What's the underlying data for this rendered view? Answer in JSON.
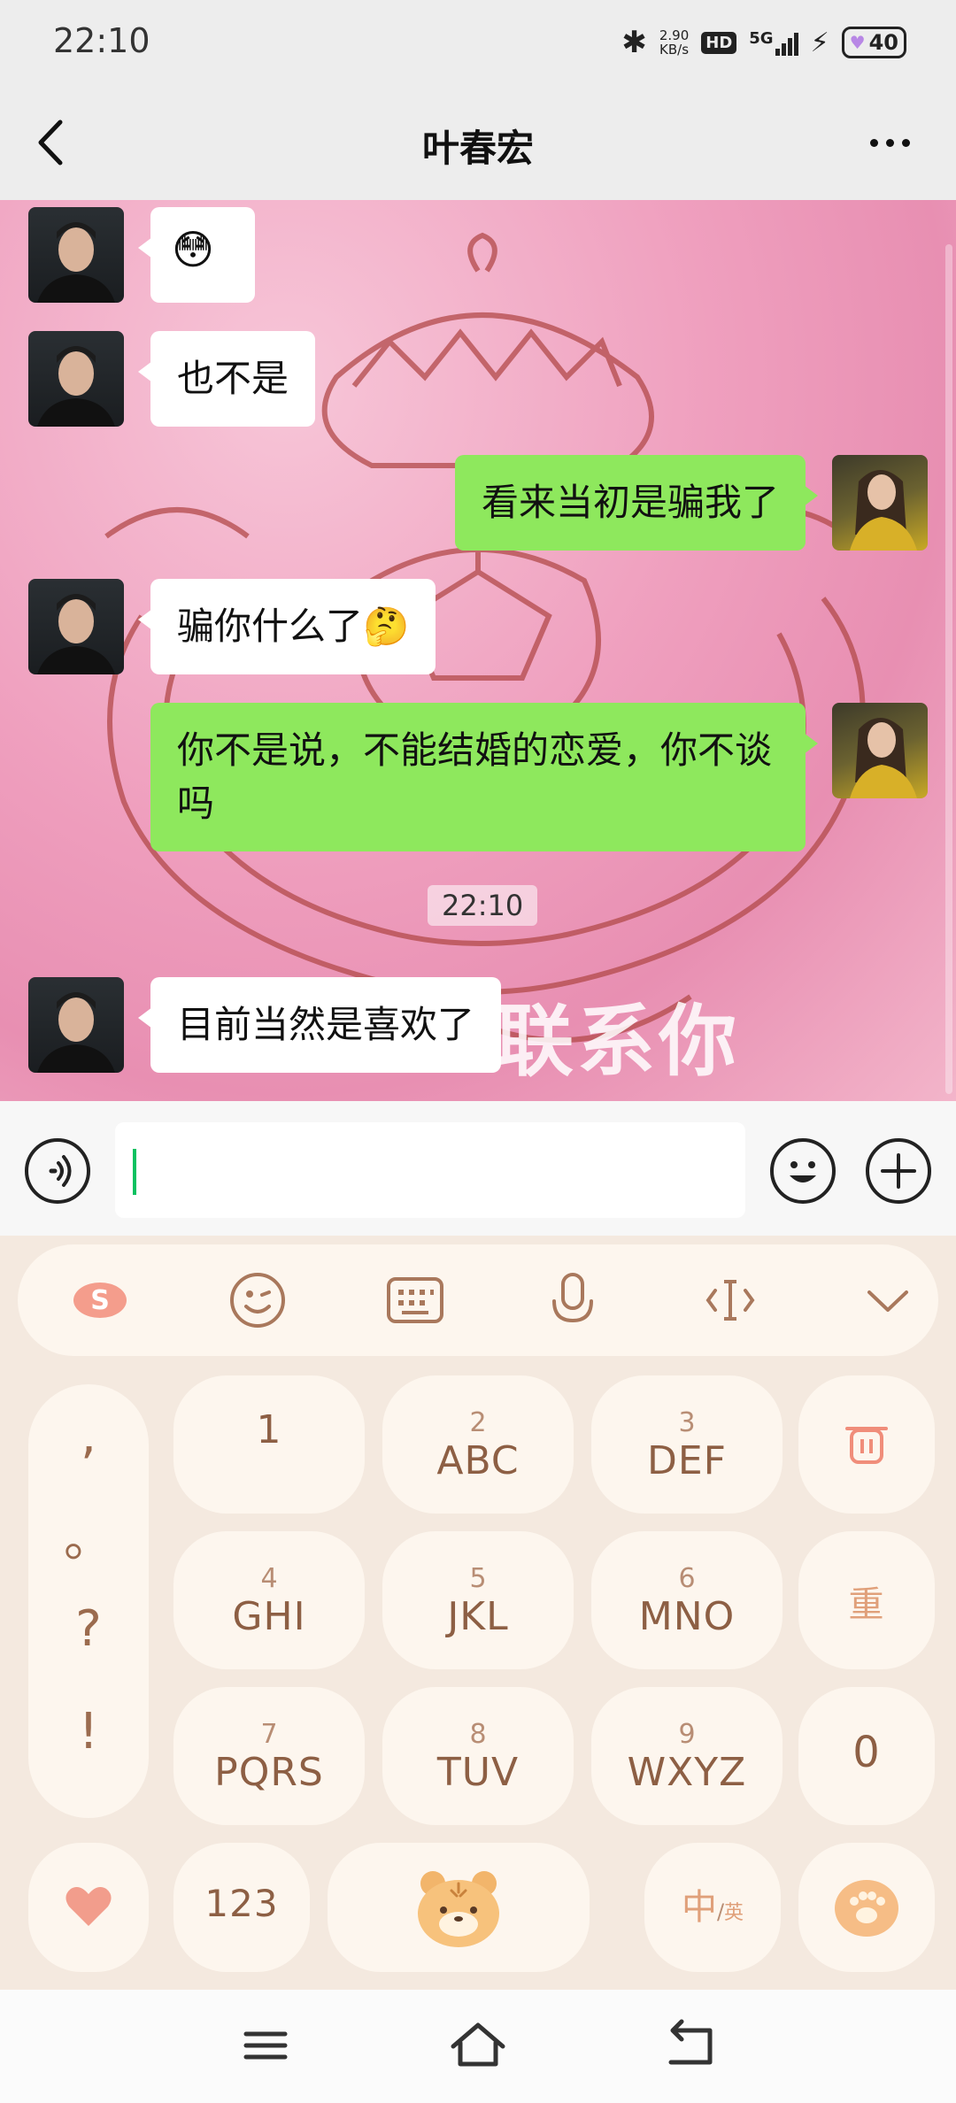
{
  "status_bar": {
    "time": "22:10",
    "net_speed_value": "2.90",
    "net_speed_unit": "KB/s",
    "hd_badge": "HD",
    "network": "5G",
    "battery": "40"
  },
  "header": {
    "title": "叶春宏",
    "back_icon": "chevron-left-icon",
    "more_icon": "more-dots-icon"
  },
  "messages": [
    {
      "side": "in",
      "text": "😳"
    },
    {
      "side": "in",
      "text": "也不是"
    },
    {
      "side": "out",
      "text": "看来当初是骗我了"
    },
    {
      "side": "in",
      "text": "骗你什么了🤔"
    },
    {
      "side": "out",
      "text": "你不是说，不能结婚的恋爱，你不谈吗"
    },
    {
      "side": "in",
      "text": "目前当然是喜欢了"
    }
  ],
  "timestamp": "22:10",
  "background_caption": "联系你",
  "input": {
    "value": ""
  },
  "keyboard": {
    "punctuation": [
      ",",
      "。",
      "?",
      "!"
    ],
    "keys": [
      {
        "num": "",
        "letters": "1"
      },
      {
        "num": "2",
        "letters": "ABC"
      },
      {
        "num": "3",
        "letters": "DEF"
      },
      {
        "num": "4",
        "letters": "GHI"
      },
      {
        "num": "5",
        "letters": "JKL"
      },
      {
        "num": "6",
        "letters": "MNO"
      },
      {
        "num": "7",
        "letters": "PQRS"
      },
      {
        "num": "8",
        "letters": "TUV"
      },
      {
        "num": "9",
        "letters": "WXYZ"
      }
    ],
    "reenter_label": "重",
    "zero_label": "0",
    "num_switch_label": "123",
    "lang_switch_main": "中",
    "lang_switch_sep": "/",
    "lang_switch_alt": "英"
  },
  "colors": {
    "outgoing_bubble": "#8ee85d",
    "incoming_bubble": "#ffffff",
    "keyboard_bg": "#f4e9df",
    "key_text": "#8d5f44",
    "caret": "#07c160"
  }
}
